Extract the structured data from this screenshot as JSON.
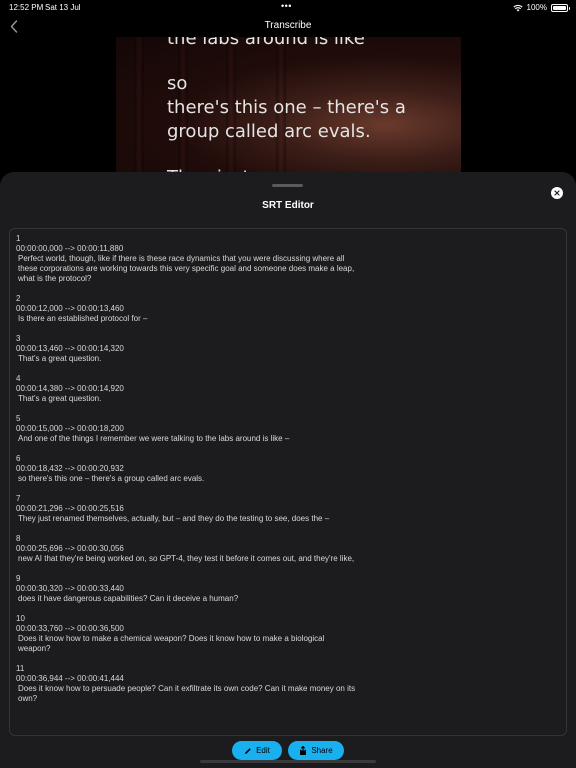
{
  "status_bar": {
    "time": "12:52 PM",
    "date": "Sat 13 Jul",
    "multitask": "•••",
    "battery": "100%",
    "icons": [
      "wifi-icon",
      "battery-icon"
    ]
  },
  "nav": {
    "title": "Transcribe",
    "back_icon": "chevron-left-icon"
  },
  "video": {
    "caption_prev": "the labs around is like",
    "caption_lines": [
      "so",
      "there's this one – there's a",
      "group called arc evals."
    ],
    "caption_next": "They just"
  },
  "sheet": {
    "title": "SRT Editor",
    "close_icon": "close-icon",
    "entries": [
      {
        "index": "1",
        "time": "00:00:00,000 --> 00:00:11,880",
        "text": "Perfect world, though, like if there is these race dynamics that you were discussing where all these corporations are working towards this very specific goal and someone does make a leap, what is the protocol?"
      },
      {
        "index": "2",
        "time": "00:00:12,000 --> 00:00:13,460",
        "text": "Is there an established protocol for –"
      },
      {
        "index": "3",
        "time": "00:00:13,460 --> 00:00:14,320",
        "text": "That's a great question."
      },
      {
        "index": "4",
        "time": "00:00:14,380 --> 00:00:14,920",
        "text": "That's a great question."
      },
      {
        "index": "5",
        "time": "00:00:15,000 --> 00:00:18,200",
        "text": "And one of the things I remember we were talking to the labs around is like –"
      },
      {
        "index": "6",
        "time": "00:00:18,432 --> 00:00:20,932",
        "text": "so there's this one – there's a group called arc evals."
      },
      {
        "index": "7",
        "time": "00:00:21,296 --> 00:00:25,516",
        "text": "They just renamed themselves, actually, but – and they do the testing to see, does the –"
      },
      {
        "index": "8",
        "time": "00:00:25,696 --> 00:00:30,056",
        "text": "new AI that they're being worked on, so GPT-4, they test it before it comes out, and they're like,"
      },
      {
        "index": "9",
        "time": "00:00:30,320 --> 00:00:33,440",
        "text": "does it have dangerous capabilities? Can it deceive a human?"
      },
      {
        "index": "10",
        "time": "00:00:33,760 --> 00:00:36,500",
        "text": "Does it know how to make a chemical weapon? Does it know how to make a biological weapon?"
      },
      {
        "index": "11",
        "time": "00:00:36,944 --> 00:00:41,444",
        "text": "Does it know how to persuade people? Can it exfiltrate its own code? Can it make money on its own?"
      }
    ]
  },
  "actions": {
    "edit_label": "Edit",
    "edit_icon": "pencil-icon",
    "share_label": "Share",
    "share_icon": "share-icon"
  },
  "colors": {
    "accent": "#19b0f0",
    "sheet_bg": "#1c1c1e",
    "background": "#000000"
  }
}
